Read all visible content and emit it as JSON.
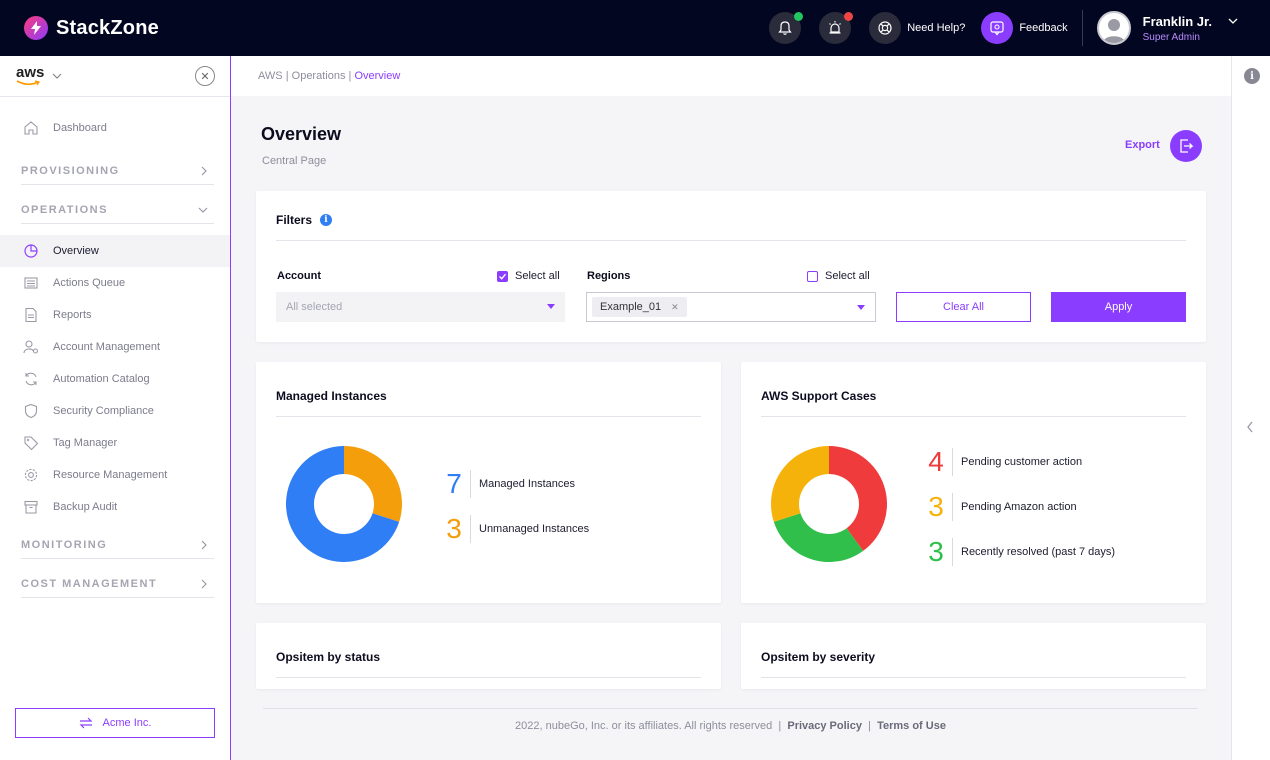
{
  "header": {
    "brand": "StackZone",
    "help_label": "Need Help?",
    "feedback_label": "Feedback",
    "user_name": "Franklin Jr.",
    "user_role": "Super Admin",
    "bell_dot_color": "#22c55e",
    "alarm_dot_color": "#ef4444"
  },
  "sidebar": {
    "cloud": "aws",
    "dashboard": "Dashboard",
    "sections": {
      "provisioning": "PROVISIONING",
      "operations": "OPERATIONS",
      "monitoring": "MONITORING",
      "cost": "COST MANAGEMENT"
    },
    "items": [
      {
        "label": "Overview",
        "icon": "pie-icon"
      },
      {
        "label": "Actions Queue",
        "icon": "queue-icon"
      },
      {
        "label": "Reports",
        "icon": "report-icon"
      },
      {
        "label": "Account Management",
        "icon": "user-gear-icon"
      },
      {
        "label": "Automation Catalog",
        "icon": "refresh-icon"
      },
      {
        "label": "Security Compliance",
        "icon": "shield-icon"
      },
      {
        "label": "Tag Manager",
        "icon": "tag-icon"
      },
      {
        "label": "Resource Management",
        "icon": "gear-icon"
      },
      {
        "label": "Backup Audit",
        "icon": "archive-icon"
      }
    ],
    "org_label": "Acme Inc."
  },
  "breadcrumb": {
    "part1": "AWS",
    "part2": "Operations",
    "current": "Overview",
    "sep": " | "
  },
  "page": {
    "title": "Overview",
    "subtitle": "Central Page",
    "export_label": "Export"
  },
  "filters": {
    "title": "Filters",
    "account_label": "Account",
    "account_select_all": "Select all",
    "account_select_all_checked": true,
    "account_value": "All selected",
    "regions_label": "Regions",
    "regions_select_all": "Select all",
    "regions_select_all_checked": false,
    "region_chip": "Example_01",
    "clear_label": "Clear All",
    "apply_label": "Apply"
  },
  "managed_instances": {
    "title": "Managed Instances",
    "stats": [
      {
        "value": "7",
        "label": "Managed Instances",
        "color": "#2f7ef5"
      },
      {
        "value": "3",
        "label": "Unmanaged Instances",
        "color": "#f59e0b"
      }
    ]
  },
  "support_cases": {
    "title": "AWS Support Cases",
    "stats": [
      {
        "value": "4",
        "label": "Pending customer action",
        "color": "#ef3b3b"
      },
      {
        "value": "3",
        "label": "Pending Amazon action",
        "color": "#f5b20b"
      },
      {
        "value": "3",
        "label": "Recently resolved (past 7 days)",
        "color": "#2fbf4a"
      }
    ]
  },
  "opsitem_status": {
    "title": "Opsitem by status"
  },
  "opsitem_severity": {
    "title": "Opsitem by severity"
  },
  "footer": {
    "copyright": "2022, nubeGo, Inc. or its affiliates. All rights reserved",
    "privacy": "Privacy Policy",
    "terms": "Terms of Use",
    "sep": "|"
  }
}
